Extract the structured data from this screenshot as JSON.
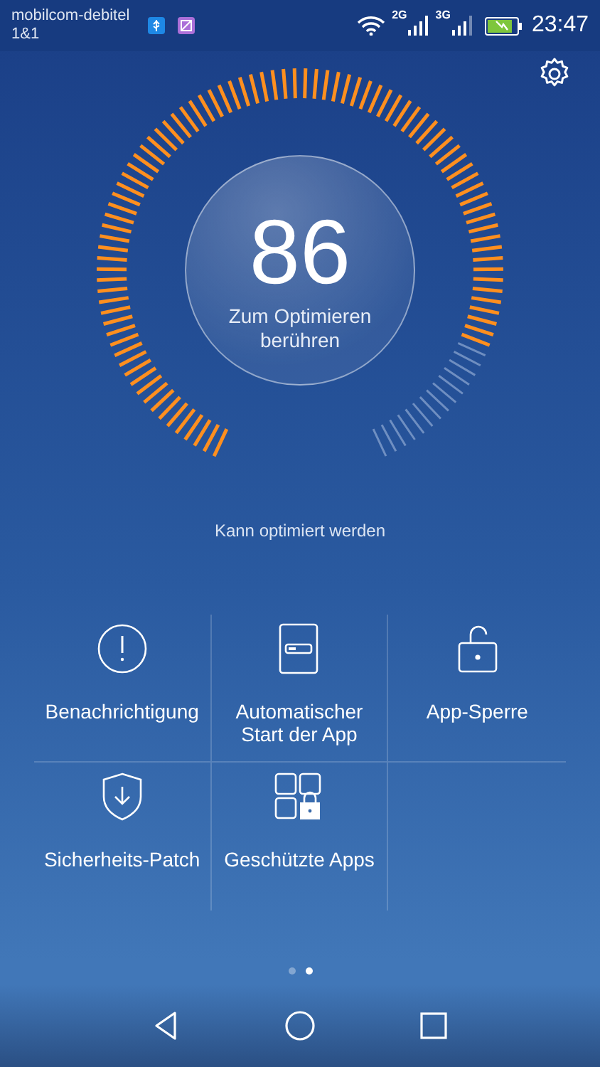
{
  "status_bar": {
    "carrier": "mobilcom-debitel",
    "carrier_2": "1&1",
    "network_1": "2G",
    "network_2": "3G",
    "time": "23:47"
  },
  "gauge": {
    "score": "86",
    "action": "Zum Optimieren berühren"
  },
  "status_text": "Kann optimiert werden",
  "tiles": [
    {
      "kind": "alert",
      "label": "Benachrichtigung"
    },
    {
      "kind": "autostart",
      "label": "Automatischer Start der App"
    },
    {
      "kind": "lock",
      "label": "App-Sperre"
    },
    {
      "kind": "shield",
      "label": "Sicherheits-Patch"
    },
    {
      "kind": "apps",
      "label": "Geschützte Apps"
    }
  ],
  "pager": [
    {
      "selected": false
    },
    {
      "selected": true
    }
  ]
}
